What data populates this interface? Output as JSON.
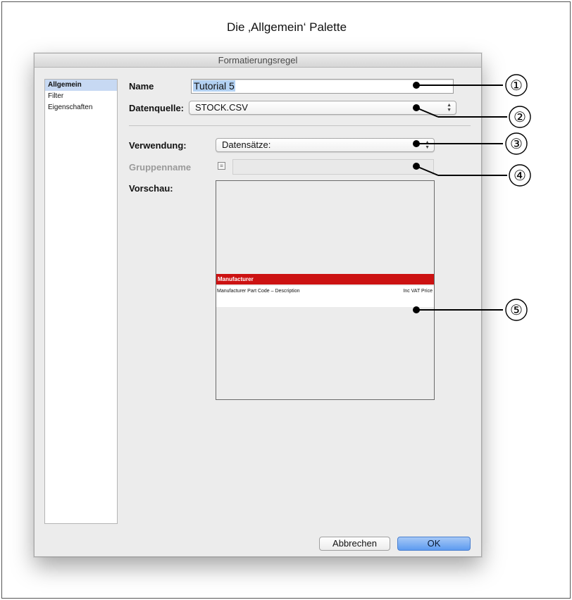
{
  "caption": "Die ‚Allgemein‘ Palette",
  "dialog": {
    "title": "Formatierungsregel",
    "sidebar": {
      "items": [
        {
          "label": "Allgemein",
          "active": true
        },
        {
          "label": "Filter",
          "active": false
        },
        {
          "label": "Eigenschaften",
          "active": false
        }
      ]
    },
    "form": {
      "name_label": "Name",
      "name_value": "Tutorial 5",
      "source_label": "Datenquelle:",
      "source_value": "STOCK.CSV",
      "usage_label": "Verwendung:",
      "usage_value": "Datensätze:",
      "group_label": "Gruppenname",
      "group_value": "",
      "preview_label": "Vorschau:"
    },
    "preview": {
      "header_text": "Manufacturer",
      "row_left": "Manufacturer Part Code – Description",
      "row_right": "Inc VAT Price"
    },
    "buttons": {
      "cancel": "Abbrechen",
      "ok": "OK"
    }
  },
  "callouts": [
    "①",
    "②",
    "③",
    "④",
    "⑤"
  ],
  "colors": {
    "preview_header": "#cc1212",
    "selection": "#c7d9f3",
    "ok_button": "#5d9bf0"
  }
}
